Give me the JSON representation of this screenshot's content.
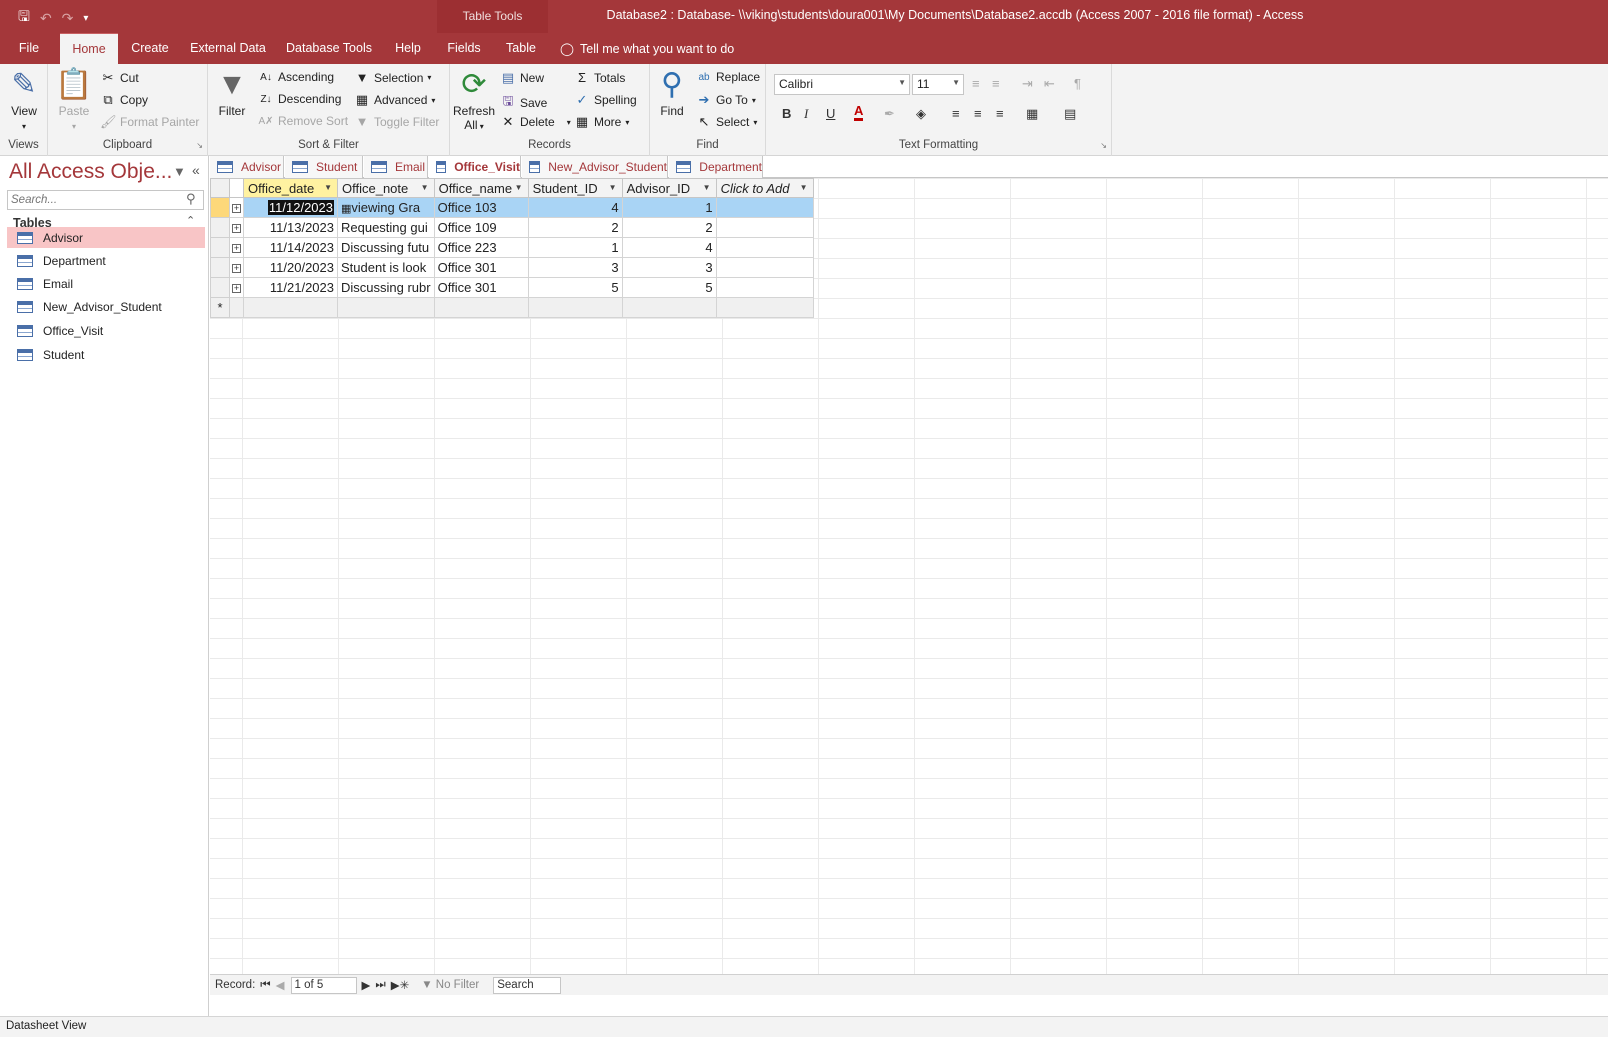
{
  "titlebar": {
    "context_tab_group": "Table Tools",
    "window_title": "Database2 : Database- \\\\viking\\students\\doura001\\My Documents\\Database2.accdb (Access 2007 - 2016 file format)  -  Access"
  },
  "ribbon_tabs": {
    "file": "File",
    "home": "Home",
    "create": "Create",
    "external_data": "External Data",
    "database_tools": "Database Tools",
    "help": "Help",
    "fields": "Fields",
    "table": "Table",
    "tell_me": "Tell me what you want to do"
  },
  "groups": {
    "views": {
      "label": "Views",
      "view": "View"
    },
    "clipboard": {
      "label": "Clipboard",
      "paste": "Paste",
      "cut": "Cut",
      "copy": "Copy",
      "format_painter": "Format Painter"
    },
    "sort_filter": {
      "label": "Sort & Filter",
      "filter": "Filter",
      "ascending": "Ascending",
      "descending": "Descending",
      "remove_sort": "Remove Sort",
      "selection": "Selection",
      "advanced": "Advanced",
      "toggle_filter": "Toggle Filter"
    },
    "records": {
      "label": "Records",
      "refresh_line1": "Refresh",
      "refresh_line2": "All",
      "new": "New",
      "save": "Save",
      "delete": "Delete",
      "totals": "Totals",
      "spelling": "Spelling",
      "more": "More"
    },
    "find": {
      "label": "Find",
      "find": "Find",
      "replace": "Replace",
      "go_to": "Go To",
      "select": "Select"
    },
    "text_formatting": {
      "label": "Text Formatting",
      "font": "Calibri",
      "size": "11",
      "bold": "B",
      "italic": "I",
      "underline": "U"
    }
  },
  "nav_pane": {
    "title": "All Access Obje...",
    "search_placeholder": "Search...",
    "category": "Tables",
    "items": [
      "Advisor",
      "Department",
      "Email",
      "New_Advisor_Student",
      "Office_Visit",
      "Student"
    ],
    "selected": "Advisor"
  },
  "doc_tabs": [
    "Advisor",
    "Student",
    "Email",
    "Office_Visit",
    "New_Advisor_Student",
    "Department"
  ],
  "active_tab": "Office_Visit",
  "datasheet": {
    "columns": [
      "Office_date",
      "Office_note",
      "Office_name",
      "Student_ID",
      "Advisor_ID",
      "Click to Add"
    ],
    "rows": [
      [
        "11/12/2023",
        "viewing Gra",
        "Office 103",
        "4",
        "1"
      ],
      [
        "11/13/2023",
        "Requesting gui",
        "Office 109",
        "2",
        "2"
      ],
      [
        "11/14/2023",
        "Discussing futu",
        "Office 223",
        "1",
        "4"
      ],
      [
        "11/20/2023",
        "Student is look",
        "Office 301",
        "3",
        "3"
      ],
      [
        "11/21/2023",
        "Discussing rubr",
        "Office 301",
        "5",
        "5"
      ]
    ],
    "new_row_marker": "*"
  },
  "record_nav": {
    "label": "Record:",
    "position": "1 of 5",
    "filter": "No Filter",
    "search": "Search"
  },
  "status": "Datasheet View",
  "colors": {
    "accent": "#a4373a",
    "selected_row": "#a9d4f5",
    "nav_selected": "#f8c5c6"
  }
}
